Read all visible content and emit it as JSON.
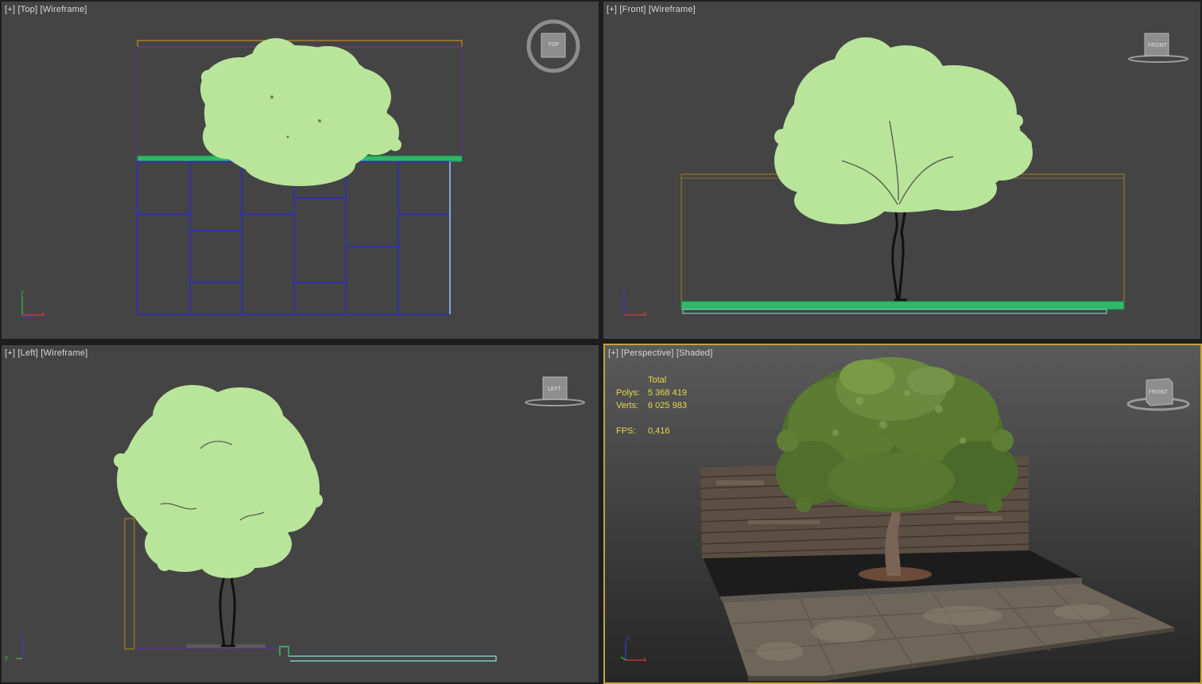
{
  "viewports": {
    "top": {
      "plus": "[+]",
      "view": "[Top]",
      "mode": "[Wireframe]",
      "cube_label": "TOP",
      "axes": {
        "v": "y",
        "h": "x"
      }
    },
    "front": {
      "plus": "[+]",
      "view": "[Front]",
      "mode": "[Wireframe]",
      "cube_label": "FRONT",
      "axes": {
        "v": "z",
        "h": "x"
      }
    },
    "left": {
      "plus": "[+]",
      "view": "[Left]",
      "mode": "[Wireframe]",
      "cube_label": "LEFT",
      "axes": {
        "v": "z",
        "h": "y"
      }
    },
    "perspective": {
      "plus": "[+]",
      "view": "[Perspective]",
      "mode": "[Shaded]",
      "cube_label": "FRONT",
      "axes": {
        "v": "z",
        "h": "x"
      }
    }
  },
  "stats": {
    "header": "Total",
    "polys_label": "Polys:",
    "polys_value": "5 368 419",
    "verts_label": "Verts:",
    "verts_value": "6 025 983",
    "fps_label": "FPS:",
    "fps_value": "0,416"
  },
  "colors": {
    "viewport_bg": "#444444",
    "active_border": "#c8a233",
    "foliage": "#b9e59a",
    "fence_wire": "#2222bb",
    "ground_wire": "#22bb66",
    "stats_text": "#e8d84a"
  }
}
